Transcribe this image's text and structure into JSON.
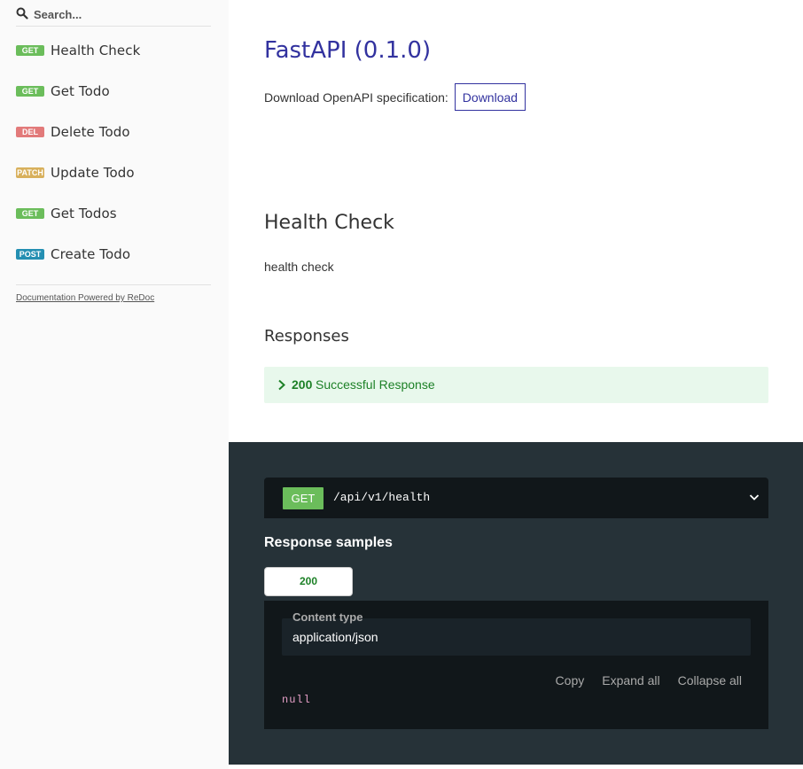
{
  "search": {
    "placeholder": "Search..."
  },
  "sidebar": {
    "items": [
      {
        "method": "GET",
        "label": "Health Check",
        "color": "#6bbd5b"
      },
      {
        "method": "GET",
        "label": "Get Todo",
        "color": "#6bbd5b"
      },
      {
        "method": "DEL",
        "label": "Delete Todo",
        "color": "#e27a7a"
      },
      {
        "method": "PATCH",
        "label": "Update Todo",
        "color": "#d8b05c"
      },
      {
        "method": "GET",
        "label": "Get Todos",
        "color": "#6bbd5b"
      },
      {
        "method": "POST",
        "label": "Create Todo",
        "color": "#248fb2"
      }
    ],
    "powered_by": "Documentation Powered by ReDoc"
  },
  "main": {
    "api_title": "FastAPI (0.1.0)",
    "download_label": "Download OpenAPI specification:",
    "download_button": "Download",
    "operation_title": "Health Check",
    "operation_description": "health check",
    "responses_title": "Responses",
    "response": {
      "code": "200",
      "text": "Successful Response"
    }
  },
  "panel": {
    "method": "GET",
    "path": "/api/v1/health",
    "samples_title": "Response samples",
    "tab_label": "200",
    "content_type_label": "Content type",
    "content_type_value": "application/json",
    "actions": {
      "copy": "Copy",
      "expand": "Expand all",
      "collapse": "Collapse all"
    },
    "json_body": "null"
  },
  "colors": {
    "accent": "#32329f",
    "success": "#1d8127",
    "success_bg": "#e8f8ec",
    "dark_panel": "#263238",
    "code_bg": "#11171a",
    "get_badge": "#6bbd5b"
  }
}
